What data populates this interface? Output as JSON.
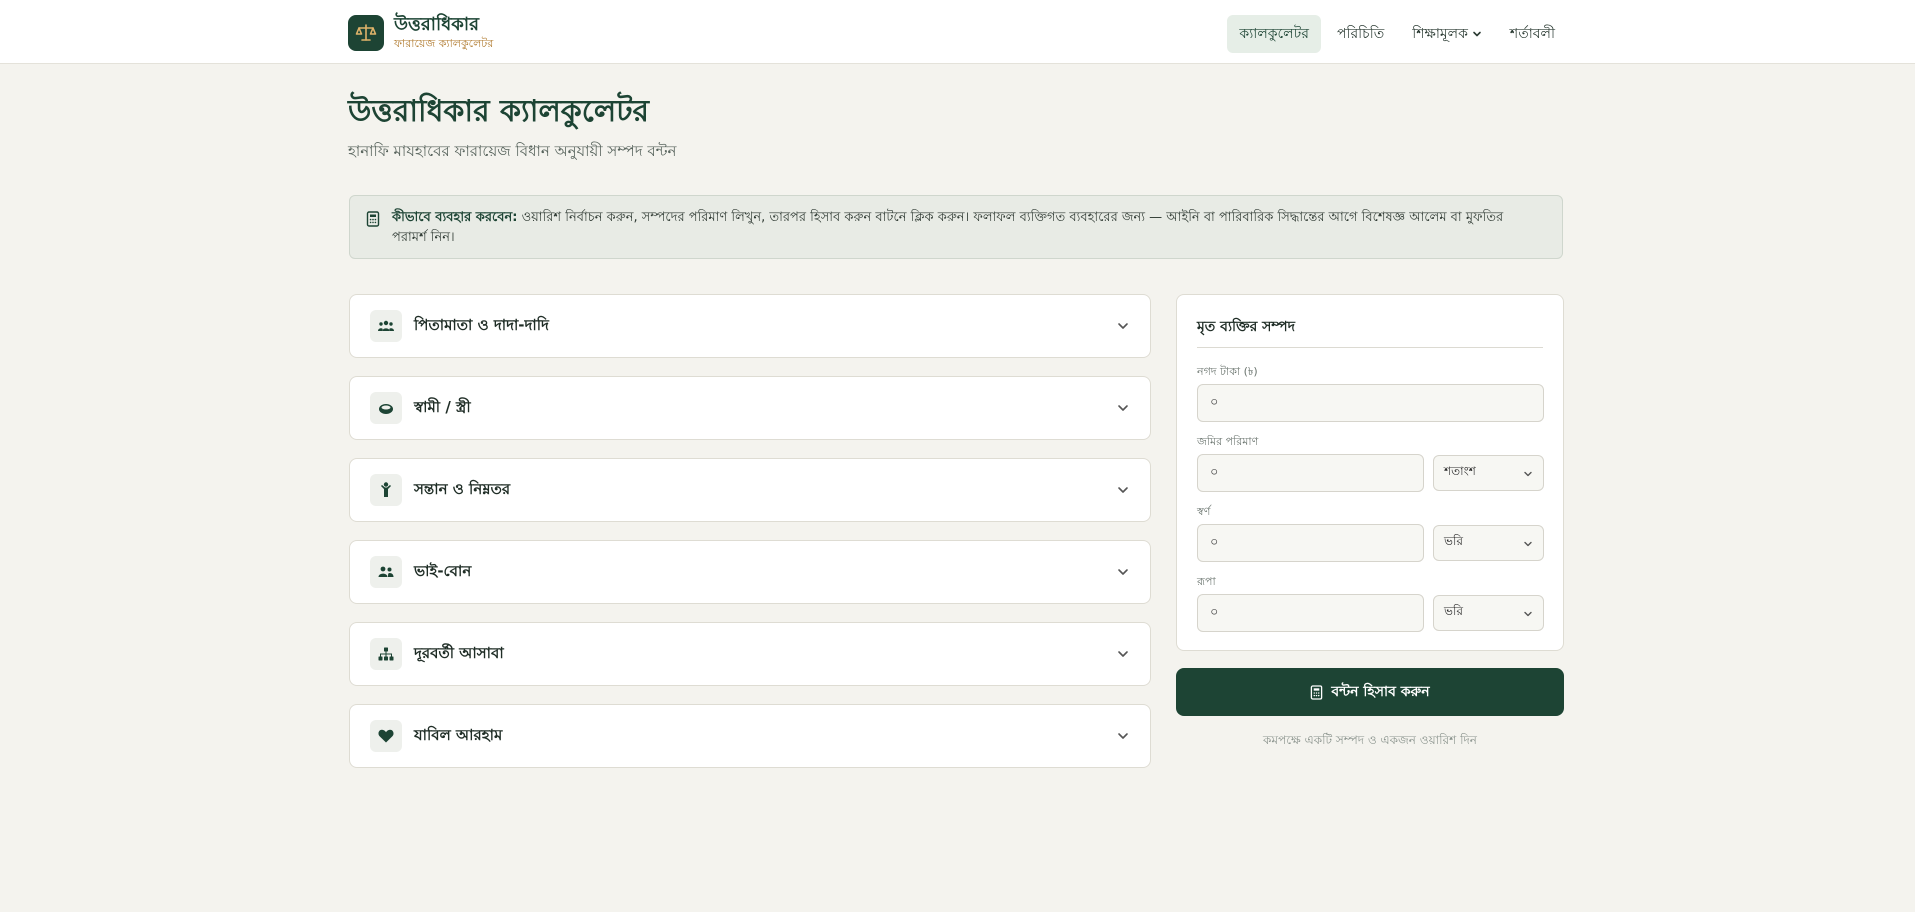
{
  "brand": {
    "title": "উত্তরাধিকার",
    "subtitle": "ফারায়েজ ক্যালকুলেটর",
    "logo_icon": "scale-icon"
  },
  "nav": {
    "items": [
      {
        "label": "ক্যালকুলেটর",
        "active": true
      },
      {
        "label": "পরিচিতি"
      },
      {
        "label": "শিক্ষামূলক",
        "has_dropdown": true
      },
      {
        "label": "শর্তাবলী"
      }
    ]
  },
  "page": {
    "title": "উত্তরাধিকার ক্যালকুলেটর",
    "subtitle": "হানাফি মাযহাবের ফারায়েজ বিধান অনুযায়ী সম্পদ বন্টন"
  },
  "notice": {
    "icon": "calculator-icon",
    "bold": "কীভাবে ব্যবহার করবেন:",
    "text": " ওয়ারিশ নির্বাচন করুন, সম্পদের পরিমাণ লিখুন, তারপর হিসাব করুন বাটনে ক্লিক করুন। ফলাফল ব্যক্তিগত ব্যবহারের জন্য — আইনি বা পারিবারিক সিদ্ধান্তের আগে বিশেষজ্ঞ আলেম বা মুফতির পরামর্শ নিন।"
  },
  "sections": [
    {
      "label": "পিতামাতা ও দাদা-দাদি",
      "icon": "family-icon"
    },
    {
      "label": "স্বামী / স্ত্রী",
      "icon": "ring-icon"
    },
    {
      "label": "সন্তান ও নিম্নতর",
      "icon": "child-icon"
    },
    {
      "label": "ভাই-বোন",
      "icon": "siblings-icon"
    },
    {
      "label": "দূরবর্তী আসাবা",
      "icon": "hierarchy-icon"
    },
    {
      "label": "যাবিল আরহাম",
      "icon": "heart-icon"
    }
  ],
  "assets": {
    "title": "মৃত ব্যক্তির সম্পদ",
    "cash": {
      "label": "নগদ টাকা (৳)",
      "value": "০"
    },
    "land": {
      "label": "জমির পরিমাণ",
      "value": "০",
      "unit": "শতাংশ"
    },
    "gold": {
      "label": "স্বর্ণ",
      "value": "০",
      "unit": "ভরি"
    },
    "silver": {
      "label": "রূপা",
      "value": "০",
      "unit": "ভরি"
    }
  },
  "calculate": {
    "label": "বন্টন হিসাব করুন",
    "icon": "calculator-icon"
  },
  "hint": "কমপক্ষে একটি সম্পদ ও একজন ওয়ারিশ দিন",
  "colors": {
    "primary": "#1d4434",
    "accent": "#b07a2e",
    "background": "#f4f3ee"
  }
}
